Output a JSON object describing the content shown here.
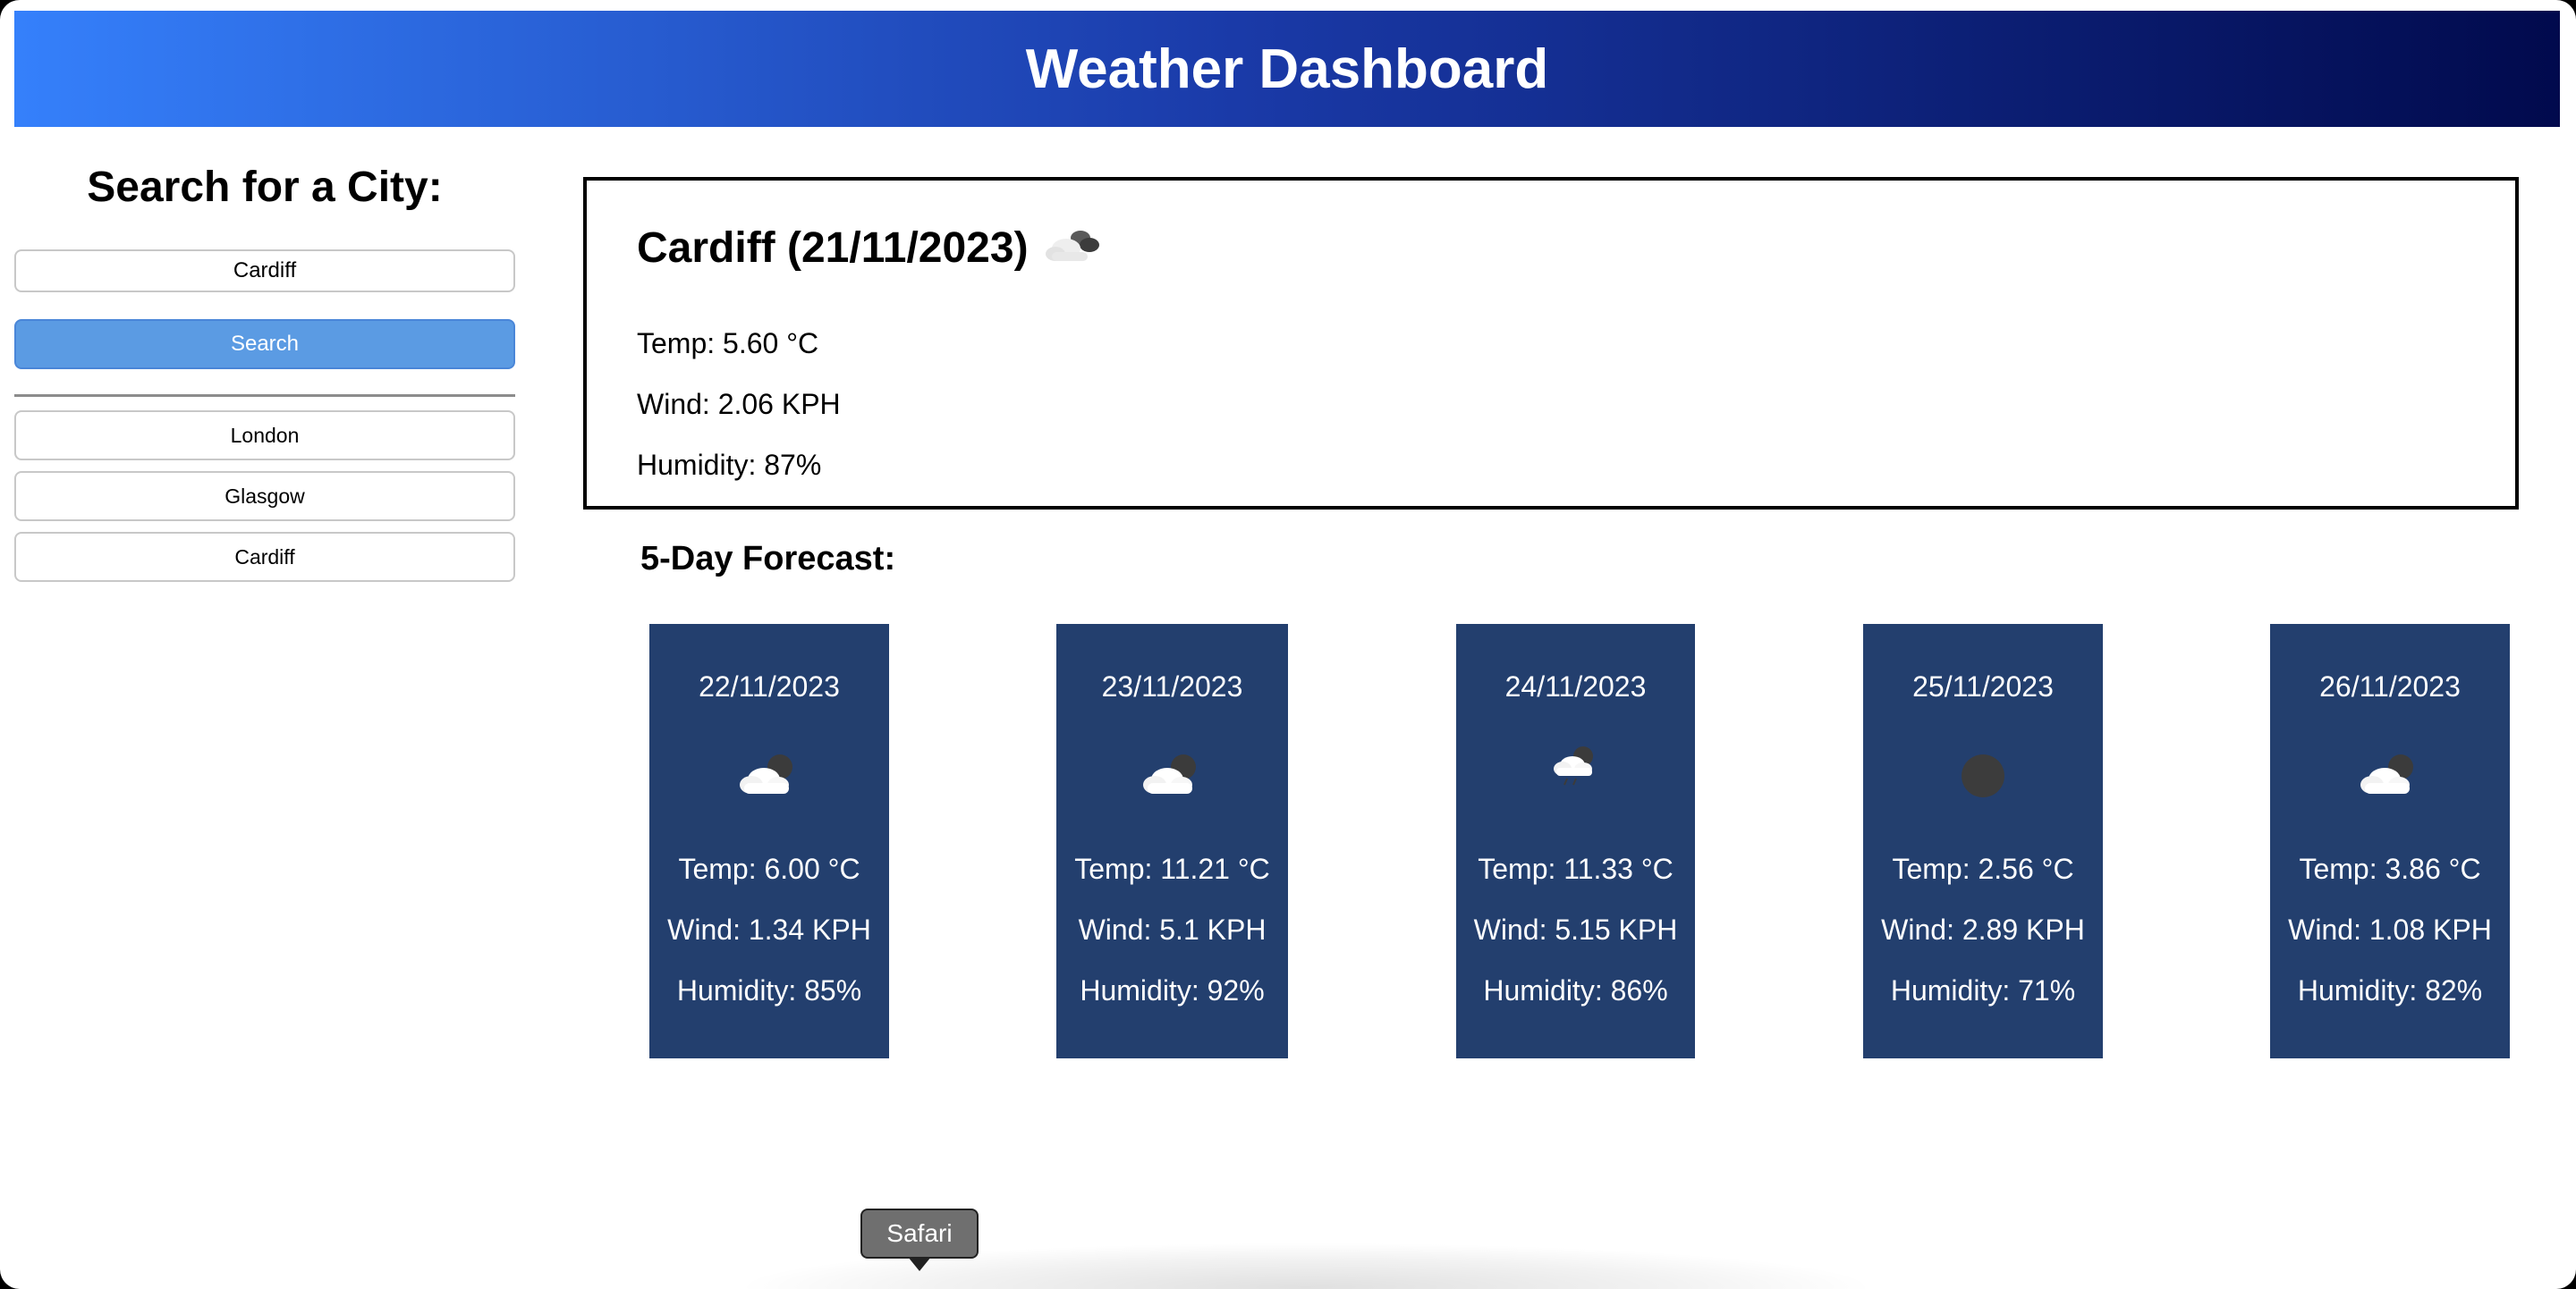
{
  "header": {
    "title": "Weather Dashboard"
  },
  "sidebar": {
    "title": "Search for a City:",
    "search_input_value": "Cardiff",
    "search_button_label": "Search",
    "history": [
      "London",
      "Glasgow",
      "Cardiff"
    ]
  },
  "current": {
    "title": "Cardiff (21/11/2023)",
    "icon": "cloudy-icon",
    "temp": "Temp: 5.60 °C",
    "wind": "Wind: 2.06 KPH",
    "humidity": "Humidity: 87%"
  },
  "forecast": {
    "title": "5-Day Forecast:",
    "days": [
      {
        "date": "22/11/2023",
        "icon": "partly-cloudy-night-icon",
        "temp": "Temp: 6.00 °C",
        "wind": "Wind: 1.34 KPH",
        "humidity": "Humidity: 85%"
      },
      {
        "date": "23/11/2023",
        "icon": "partly-cloudy-night-icon",
        "temp": "Temp: 11.21 °C",
        "wind": "Wind: 5.1 KPH",
        "humidity": "Humidity: 92%"
      },
      {
        "date": "24/11/2023",
        "icon": "rain-cloud-icon",
        "temp": "Temp: 11.33 °C",
        "wind": "Wind: 5.15 KPH",
        "humidity": "Humidity: 86%"
      },
      {
        "date": "25/11/2023",
        "icon": "clear-night-icon",
        "temp": "Temp: 2.56 °C",
        "wind": "Wind: 2.89 KPH",
        "humidity": "Humidity: 71%"
      },
      {
        "date": "26/11/2023",
        "icon": "partly-cloudy-night-icon",
        "temp": "Temp: 3.86 °C",
        "wind": "Wind: 1.08 KPH",
        "humidity": "Humidity: 82%"
      }
    ]
  },
  "tooltip": {
    "label": "Safari"
  },
  "colors": {
    "header_gradient_start": "#3580fb",
    "header_gradient_end": "#010a4d",
    "search_button": "#5b9be3",
    "forecast_card": "#233f6e"
  }
}
